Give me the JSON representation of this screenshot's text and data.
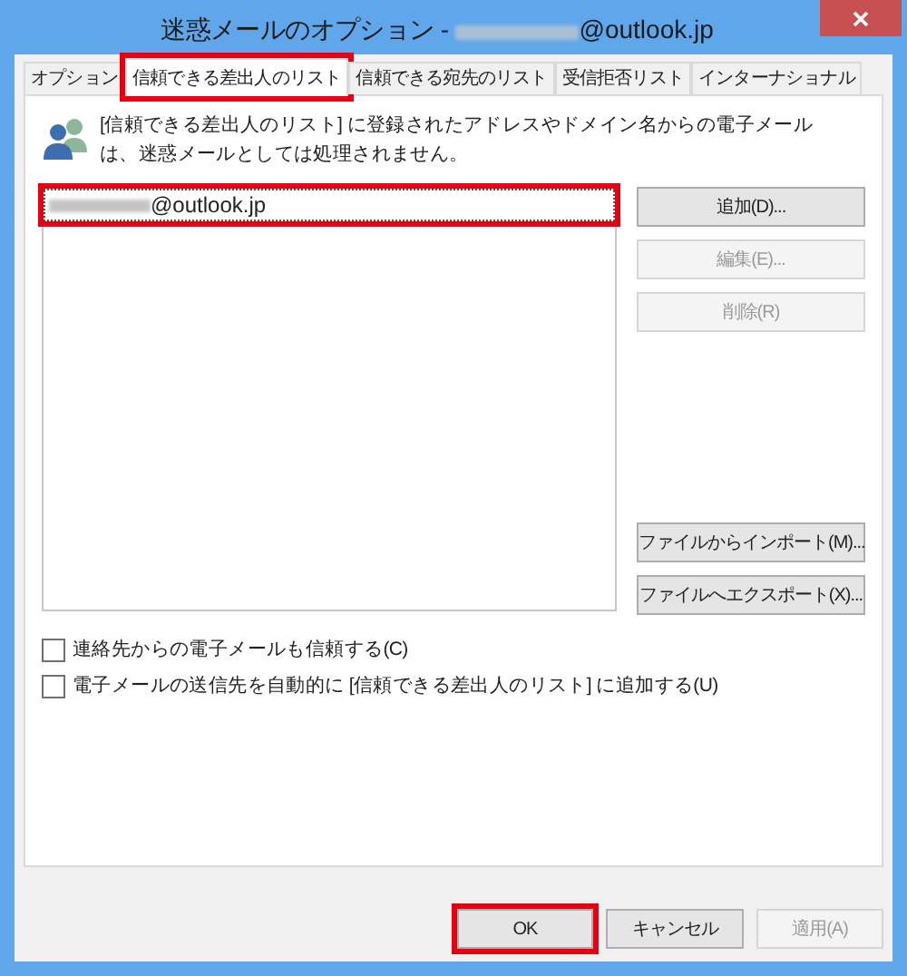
{
  "window": {
    "title": "迷惑メールのオプション -",
    "title_address": "@outlook.jp"
  },
  "tabs": [
    {
      "label": "オプション",
      "selected": false,
      "highlighted": false
    },
    {
      "label": "信頼できる差出人のリスト",
      "selected": true,
      "highlighted": true
    },
    {
      "label": "信頼できる宛先のリスト",
      "selected": false,
      "highlighted": false
    },
    {
      "label": "受信拒否リスト",
      "selected": false,
      "highlighted": false
    },
    {
      "label": "インターナショナル",
      "selected": false,
      "highlighted": false
    }
  ],
  "description": "[信頼できる差出人のリスト] に登録されたアドレスやドメイン名からの電子メールは、迷惑メールとしては処理されません。",
  "list": [
    {
      "address": "@outlook.jp",
      "selected": true,
      "highlighted": true
    }
  ],
  "side_buttons": [
    {
      "label": "追加(D)...",
      "disabled": false
    },
    {
      "label": "編集(E)...",
      "disabled": true
    },
    {
      "label": "削除(R)",
      "disabled": true
    }
  ],
  "file_buttons": [
    {
      "label": "ファイルからインポート(M)..."
    },
    {
      "label": "ファイルへエクスポート(X)..."
    }
  ],
  "options": [
    {
      "label": "連絡先からの電子メールも信頼する(C)",
      "checked": false
    },
    {
      "label": "電子メールの送信先を自動的に [信頼できる差出人のリスト] に追加する(U)",
      "checked": false
    }
  ],
  "footer_buttons": [
    {
      "label": "OK",
      "disabled": false,
      "highlighted": true
    },
    {
      "label": "キャンセル",
      "disabled": false,
      "highlighted": false
    },
    {
      "label": "適用(A)",
      "disabled": true,
      "highlighted": false
    }
  ]
}
